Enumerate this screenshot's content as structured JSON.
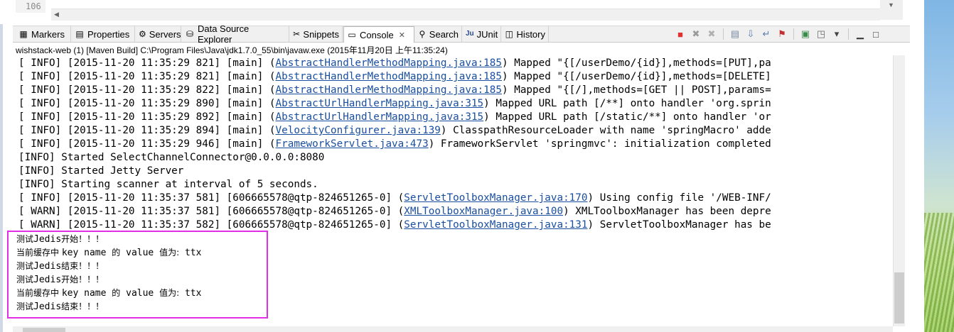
{
  "editor": {
    "line_number": "106"
  },
  "tabs": [
    {
      "label": "Markers",
      "icon": "markers-icon",
      "glyph": "▦",
      "active": false
    },
    {
      "label": "Properties",
      "icon": "properties-icon",
      "glyph": "▤",
      "active": false
    },
    {
      "label": "Servers",
      "icon": "servers-icon",
      "glyph": "⚙",
      "active": false
    },
    {
      "label": "Data Source Explorer",
      "icon": "data-source-icon",
      "glyph": "⛁",
      "active": false
    },
    {
      "label": "Snippets",
      "icon": "snippets-icon",
      "glyph": "✂",
      "active": false
    },
    {
      "label": "Console",
      "icon": "console-icon",
      "glyph": "▭",
      "active": true,
      "close": "✕"
    },
    {
      "label": "Search",
      "icon": "search-icon",
      "glyph": "⚲",
      "active": false
    },
    {
      "label": "JUnit",
      "icon": "junit-icon",
      "glyph": "Ju",
      "active": false
    },
    {
      "label": "History",
      "icon": "history-icon",
      "glyph": "◫",
      "active": false
    }
  ],
  "launch_title": "wishstack-web (1) [Maven Build] C:\\Program Files\\Java\\jdk1.7.0_55\\bin\\javaw.exe (2015年11月20日 上午11:35:24)",
  "console_lines": [
    {
      "prefix": "[ INFO] [2015-11-20 11:35:29 821] [main] (",
      "link": "AbstractHandlerMethodMapping.java:185",
      "suffix": ") Mapped \"{[/userDemo/{id}],methods=[PUT],pa"
    },
    {
      "prefix": "[ INFO] [2015-11-20 11:35:29 821] [main] (",
      "link": "AbstractHandlerMethodMapping.java:185",
      "suffix": ") Mapped \"{[/userDemo/{id}],methods=[DELETE]"
    },
    {
      "prefix": "[ INFO] [2015-11-20 11:35:29 822] [main] (",
      "link": "AbstractHandlerMethodMapping.java:185",
      "suffix": ") Mapped \"{[/],methods=[GET || POST],params="
    },
    {
      "prefix": "[ INFO] [2015-11-20 11:35:29 890] [main] (",
      "link": "AbstractUrlHandlerMapping.java:315",
      "suffix": ") Mapped URL path [/**] onto handler 'org.sprin"
    },
    {
      "prefix": "[ INFO] [2015-11-20 11:35:29 892] [main] (",
      "link": "AbstractUrlHandlerMapping.java:315",
      "suffix": ") Mapped URL path [/static/**] onto handler 'or"
    },
    {
      "prefix": "[ INFO] [2015-11-20 11:35:29 894] [main] (",
      "link": "VelocityConfigurer.java:139",
      "suffix": ") ClasspathResourceLoader with name 'springMacro' adde"
    },
    {
      "prefix": "[ INFO] [2015-11-20 11:35:29 946] [main] (",
      "link": "FrameworkServlet.java:473",
      "suffix": ") FrameworkServlet 'springmvc': initialization completed"
    },
    {
      "prefix": "[INFO] Started SelectChannelConnector@0.0.0.0:8080",
      "link": "",
      "suffix": ""
    },
    {
      "prefix": "[INFO] Started Jetty Server",
      "link": "",
      "suffix": ""
    },
    {
      "prefix": "[INFO] Starting scanner at interval of 5 seconds.",
      "link": "",
      "suffix": ""
    },
    {
      "prefix": "[ INFO] [2015-11-20 11:35:37 581] [606665578@qtp-824651265-0] (",
      "link": "ServletToolboxManager.java:170",
      "suffix": ") Using config file '/WEB-INF/"
    },
    {
      "prefix": "[ WARN] [2015-11-20 11:35:37 581] [606665578@qtp-824651265-0] (",
      "link": "XMLToolboxManager.java:100",
      "suffix": ") XMLToolboxManager has been depre"
    },
    {
      "prefix": "[ WARN] [2015-11-20 11:35:37 582] [606665578@qtp-824651265-0] (",
      "link": "ServletToolboxManager.java:131",
      "suffix": ") ServletToolboxManager has be"
    }
  ],
  "jedis_lines": [
    [
      {
        "t": "测试",
        "cn": true
      },
      {
        "t": "Jedis",
        "cn": false
      },
      {
        "t": "开始！！！",
        "cn": true
      }
    ],
    [
      {
        "t": "当前缓存中 ",
        "cn": true
      },
      {
        "t": "key name ",
        "cn": false
      },
      {
        "t": "的",
        "cn": true
      },
      {
        "t": " value ",
        "cn": false
      },
      {
        "t": "值为:",
        "cn": true
      },
      {
        "t": " ttx",
        "cn": false
      }
    ],
    [
      {
        "t": "测试",
        "cn": true
      },
      {
        "t": "Jedis",
        "cn": false
      },
      {
        "t": "结束！！！",
        "cn": true
      }
    ],
    [
      {
        "t": "测试",
        "cn": true
      },
      {
        "t": "Jedis",
        "cn": false
      },
      {
        "t": "开始！！！",
        "cn": true
      }
    ],
    [
      {
        "t": "当前缓存中 ",
        "cn": true
      },
      {
        "t": "key name ",
        "cn": false
      },
      {
        "t": "的",
        "cn": true
      },
      {
        "t": " value ",
        "cn": false
      },
      {
        "t": "值为:",
        "cn": true
      },
      {
        "t": " ttx",
        "cn": false
      }
    ],
    [
      {
        "t": "测试",
        "cn": true
      },
      {
        "t": "Jedis",
        "cn": false
      },
      {
        "t": "结束！！！",
        "cn": true
      }
    ]
  ],
  "toolbar": [
    {
      "icon": "terminate-icon",
      "glyph": "■",
      "color": "#e03030"
    },
    {
      "icon": "remove-launch-icon",
      "glyph": "✖",
      "color": "#9a9a9a"
    },
    {
      "icon": "remove-all-terminated-icon",
      "glyph": "✖",
      "color": "#b0b0b0"
    },
    {
      "icon": "clear-console-icon",
      "glyph": "▤",
      "color": "#7a8aa0"
    },
    {
      "icon": "scroll-lock-icon",
      "glyph": "⇩",
      "color": "#5a7fb0"
    },
    {
      "icon": "word-wrap-icon",
      "glyph": "↵",
      "color": "#5a7fb0"
    },
    {
      "icon": "pin-console-icon",
      "glyph": "⚑",
      "color": "#c03030"
    },
    {
      "icon": "display-selected-console-icon",
      "glyph": "▣",
      "color": "#3a8a4a"
    },
    {
      "icon": "open-console-icon",
      "glyph": "◳",
      "color": "#6a6a6a"
    },
    {
      "icon": "view-menu-icon",
      "glyph": "▾",
      "color": "#444"
    },
    {
      "icon": "minimize-icon",
      "glyph": "▁",
      "color": "#333"
    },
    {
      "icon": "maximize-icon",
      "glyph": "□",
      "color": "#333"
    }
  ],
  "colors": {
    "link": "#1a4fa0",
    "highlight": "#e22ee6"
  }
}
